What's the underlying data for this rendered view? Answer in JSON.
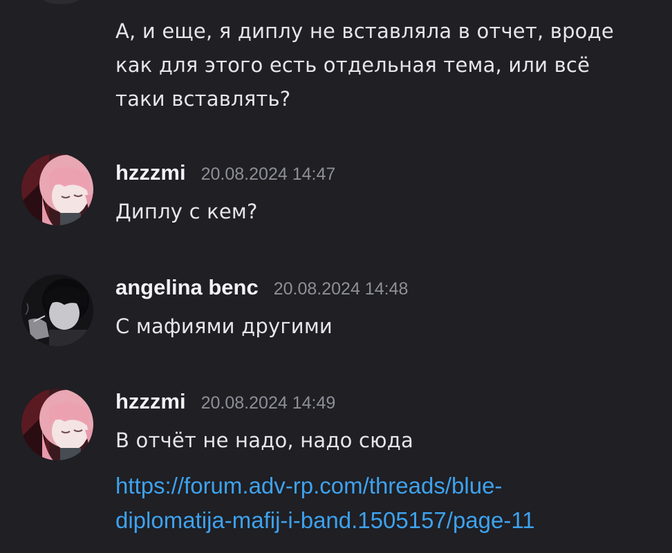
{
  "messages": {
    "continued": {
      "lines": [
        "А, и еще, я диплу не вставляла в отчет, вроде",
        "как для этого есть отдельная тема, или всё",
        "таки вставлять?"
      ]
    },
    "m1": {
      "author": "hzzzmi",
      "timestamp": "20.08.2024 14:47",
      "text": "Диплу с кем?",
      "avatar_icon": "anime-girl-pink-hair-avatar"
    },
    "m2": {
      "author": "angelina benc",
      "timestamp": "20.08.2024 14:48",
      "text": "С мафиями другими",
      "avatar_icon": "dark-haired-smoking-avatar"
    },
    "m3": {
      "author": "hzzzmi",
      "timestamp": "20.08.2024 14:49",
      "text": "В отчёт не надо, надо сюда",
      "link_lines": [
        "https://forum.adv-rp.com/threads/blue-",
        "diplomatija-mafij-i-band.1505157/page-11"
      ],
      "avatar_icon": "anime-girl-pink-hair-avatar"
    }
  },
  "colors": {
    "background": "#1f1f24",
    "text": "#e6e6ea",
    "timestamp": "#8e8f97",
    "link": "#3ea2ee"
  }
}
